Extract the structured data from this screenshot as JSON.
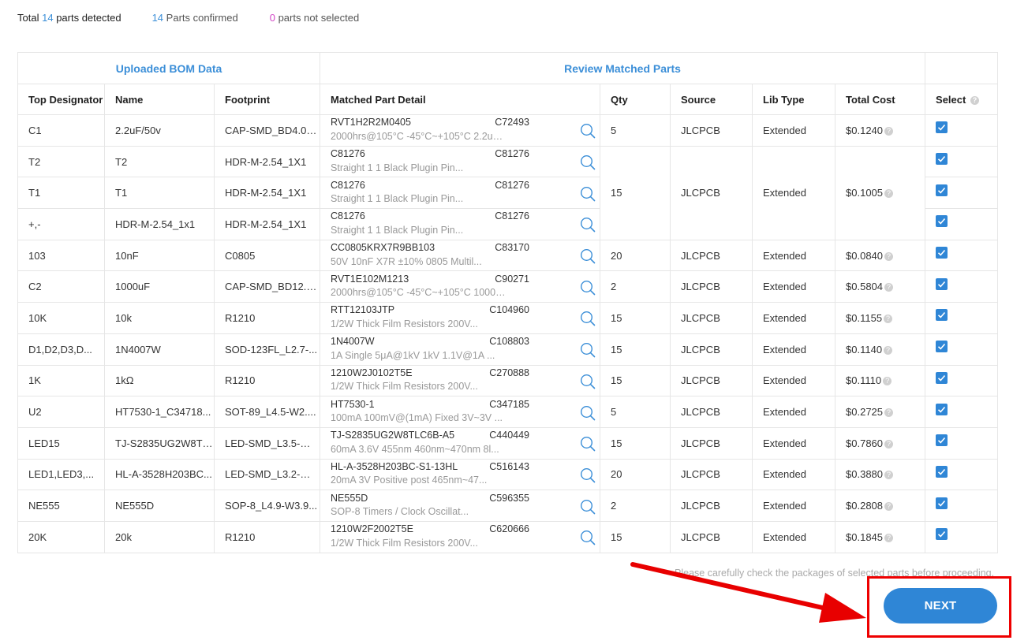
{
  "summary": {
    "total_prefix": "Total",
    "total_count": "14",
    "total_suffix": "parts detected",
    "confirmed_count": "14",
    "confirmed_label": "Parts confirmed",
    "not_selected_count": "0",
    "not_selected_label": "parts not selected"
  },
  "table": {
    "group_uploaded": "Uploaded BOM Data",
    "group_review": "Review Matched Parts",
    "headers": {
      "designator": "Top Designator",
      "name": "Name",
      "footprint": "Footprint",
      "detail": "Matched Part Detail",
      "qty": "Qty",
      "source": "Source",
      "lib_type": "Lib Type",
      "total_cost": "Total Cost",
      "select": "Select"
    },
    "rows": [
      {
        "designator": "C1",
        "name": "2.2uF/50v",
        "footprint": "CAP-SMD_BD4.0-L...",
        "mpn": "RVT1H2R2M0405",
        "part_code": "C72493",
        "desc": "2000hrs@105°C -45°C~+105°C 2.2uF ...",
        "qty": "5",
        "source": "JLCPCB",
        "lib_type": "Extended",
        "total_cost": "$0.1240"
      },
      {
        "designator": "T2",
        "name": "T2",
        "footprint": "HDR-M-2.54_1X1",
        "mpn": "C81276",
        "part_code": "C81276",
        "desc": "Straight 1 1 Black Plugin Pin..."
      },
      {
        "designator": "T1",
        "name": "T1",
        "footprint": "HDR-M-2.54_1X1",
        "mpn": "C81276",
        "part_code": "C81276",
        "desc": "Straight 1 1 Black Plugin Pin..."
      },
      {
        "designator": "+,-",
        "name": "HDR-M-2.54_1x1",
        "footprint": "HDR-M-2.54_1X1",
        "mpn": "C81276",
        "part_code": "C81276",
        "desc": "Straight 1 1 Black Plugin Pin..."
      },
      {
        "designator": "103",
        "name": "10nF",
        "footprint": "C0805",
        "mpn": "CC0805KRX7R9BB103",
        "part_code": "C83170",
        "desc": "50V 10nF X7R ±10% 0805 Multil...",
        "qty": "20",
        "source": "JLCPCB",
        "lib_type": "Extended",
        "total_cost": "$0.0840"
      },
      {
        "designator": "C2",
        "name": "1000uF",
        "footprint": "CAP-SMD_BD12.5-...",
        "mpn": "RVT1E102M1213",
        "part_code": "C90271",
        "desc": "2000hrs@105°C -45°C~+105°C 1000uF...",
        "qty": "2",
        "source": "JLCPCB",
        "lib_type": "Extended",
        "total_cost": "$0.5804"
      },
      {
        "designator": "10K",
        "name": "10k",
        "footprint": "R1210",
        "mpn": "RTT12103JTP",
        "part_code": "C104960",
        "desc": "1/2W Thick Film Resistors 200V...",
        "qty": "15",
        "source": "JLCPCB",
        "lib_type": "Extended",
        "total_cost": "$0.1155"
      },
      {
        "designator": "D1,D2,D3,D...",
        "name": "1N4007W",
        "footprint": "SOD-123FL_L2.7-...",
        "mpn": "1N4007W",
        "part_code": "C108803",
        "desc": "1A Single 5μA@1kV 1kV 1.1V@1A ...",
        "qty": "15",
        "source": "JLCPCB",
        "lib_type": "Extended",
        "total_cost": "$0.1140"
      },
      {
        "designator": "1K",
        "name": "1kΩ",
        "footprint": "R1210",
        "mpn": "1210W2J0102T5E",
        "part_code": "C270888",
        "desc": "1/2W Thick Film Resistors 200V...",
        "qty": "15",
        "source": "JLCPCB",
        "lib_type": "Extended",
        "total_cost": "$0.1110"
      },
      {
        "designator": "U2",
        "name": "HT7530-1_C34718...",
        "footprint": "SOT-89_L4.5-W2....",
        "mpn": "HT7530-1",
        "part_code": "C347185",
        "desc": "100mA 100mV@(1mA) Fixed 3V~3V ...",
        "qty": "5",
        "source": "JLCPCB",
        "lib_type": "Extended",
        "total_cost": "$0.2725"
      },
      {
        "designator": "LED15",
        "name": "TJ-S2835UG2W8TL...",
        "footprint": "LED-SMD_L3.5-W2...",
        "mpn": "TJ-S2835UG2W8TLC6B-A5",
        "part_code": "C440449",
        "desc": "60mA 3.6V 455nm 460nm~470nm 8l...",
        "qty": "15",
        "source": "JLCPCB",
        "lib_type": "Extended",
        "total_cost": "$0.7860"
      },
      {
        "designator": "LED1,LED3,...",
        "name": "HL-A-3528H203BC...",
        "footprint": "LED-SMD_L3.2-W2...",
        "mpn": "HL-A-3528H203BC-S1-13HL",
        "part_code": "C516143",
        "desc": "20mA 3V Positive post 465nm~47...",
        "qty": "20",
        "source": "JLCPCB",
        "lib_type": "Extended",
        "total_cost": "$0.3880"
      },
      {
        "designator": "NE555",
        "name": "NE555D",
        "footprint": "SOP-8_L4.9-W3.9...",
        "mpn": "NE555D",
        "part_code": "C596355",
        "desc": "SOP-8 Timers / Clock Oscillat...",
        "qty": "2",
        "source": "JLCPCB",
        "lib_type": "Extended",
        "total_cost": "$0.2808"
      },
      {
        "designator": "20K",
        "name": "20k",
        "footprint": "R1210",
        "mpn": "1210W2F2002T5E",
        "part_code": "C620666",
        "desc": "1/2W Thick Film Resistors 200V...",
        "qty": "15",
        "source": "JLCPCB",
        "lib_type": "Extended",
        "total_cost": "$0.1845"
      }
    ],
    "merged_group": {
      "qty": "15",
      "source": "JLCPCB",
      "lib_type": "Extended",
      "total_cost": "$0.1005"
    }
  },
  "footer": {
    "note": "Please carefully check the packages of selected parts before proceeding.",
    "next_label": "NEXT"
  },
  "icons": {
    "search": "magnifier-icon",
    "help": "question-circle-icon",
    "check": "checkbox-checked-icon"
  },
  "colors": {
    "accent": "#2f86d6",
    "link_blue": "#3c8fd8",
    "highlight_red": "#ee0000",
    "pink_count": "#d246c6"
  }
}
